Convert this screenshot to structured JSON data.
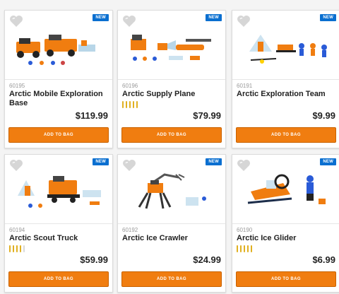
{
  "colors": {
    "accent": "#f07d10",
    "badge": "#0a6fd0"
  },
  "products": [
    {
      "sku": "60195",
      "name": "Arctic Mobile Exploration Base",
      "price": "$119.99",
      "badge": "NEW",
      "button": "ADD TO BAG",
      "rating_stars": 0,
      "icon": "heart-icon"
    },
    {
      "sku": "60196",
      "name": "Arctic Supply Plane",
      "price": "$79.99",
      "badge": "NEW",
      "button": "ADD TO BAG",
      "rating_stars": 5,
      "icon": "heart-icon"
    },
    {
      "sku": "60191",
      "name": "Arctic Exploration Team",
      "price": "$9.99",
      "badge": "NEW",
      "button": "ADD TO BAG",
      "rating_stars": 0,
      "icon": "heart-icon"
    },
    {
      "sku": "60194",
      "name": "Arctic Scout Truck",
      "price": "$59.99",
      "badge": "NEW",
      "button": "ADD TO BAG",
      "rating_stars": 4,
      "icon": "heart-icon"
    },
    {
      "sku": "60192",
      "name": "Arctic Ice Crawler",
      "price": "$24.99",
      "badge": "NEW",
      "button": "ADD TO BAG",
      "rating_stars": 0,
      "icon": "heart-icon"
    },
    {
      "sku": "60190",
      "name": "Arctic Ice Glider",
      "price": "$6.99",
      "badge": "NEW",
      "button": "ADD TO BAG",
      "rating_stars": 5,
      "icon": "heart-icon"
    }
  ]
}
